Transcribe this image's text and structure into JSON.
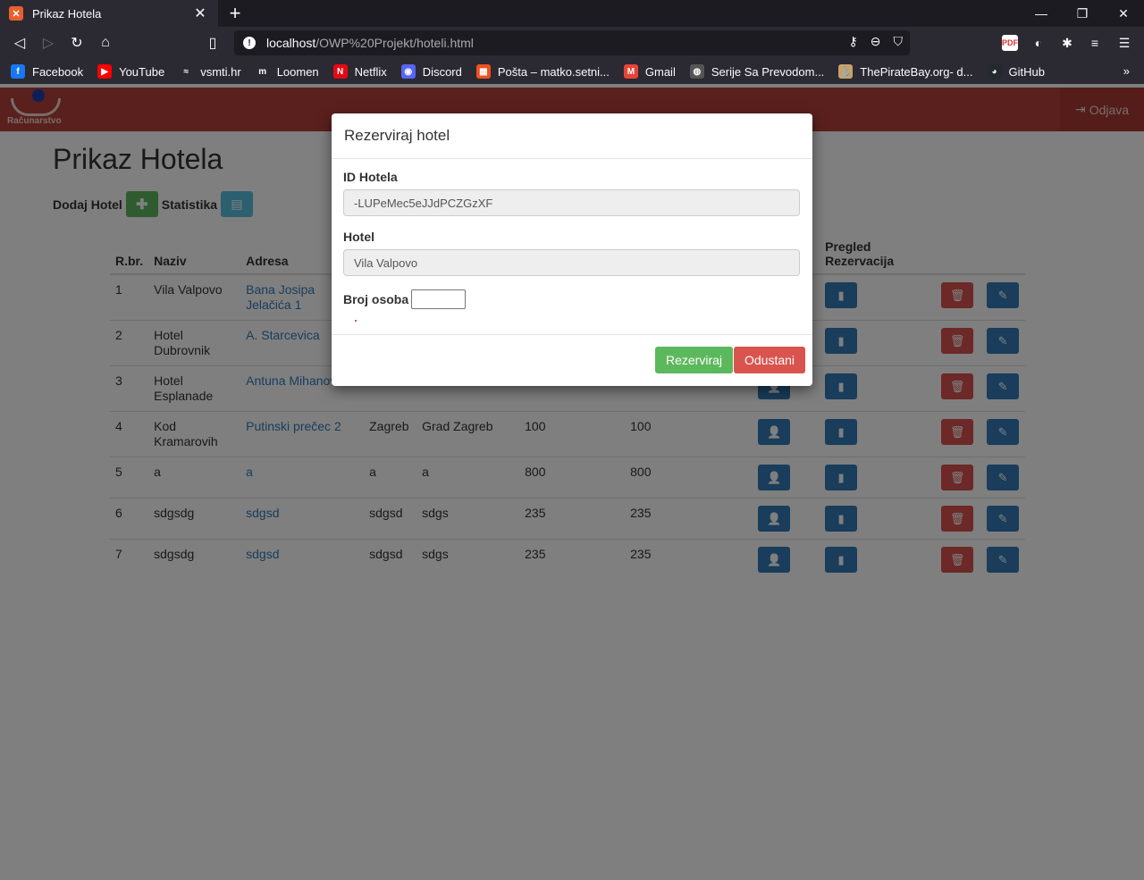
{
  "browser": {
    "tab_title": "Prikaz Hotela",
    "url_host": "localhost",
    "url_path": "/OWP%20Projekt/hoteli.html",
    "bookmarks": [
      {
        "label": "Facebook",
        "icon": "facebook-icon",
        "color": "#1877f2",
        "glyph": "f"
      },
      {
        "label": "YouTube",
        "icon": "youtube-icon",
        "color": "#ff0000",
        "glyph": "▶"
      },
      {
        "label": "vsmti.hr",
        "icon": "vsmti-icon",
        "color": "#2b2a33",
        "glyph": "≈"
      },
      {
        "label": "Loomen",
        "icon": "loomen-icon",
        "color": "#2b2a33",
        "glyph": "m"
      },
      {
        "label": "Netflix",
        "icon": "netflix-icon",
        "color": "#e50914",
        "glyph": "N"
      },
      {
        "label": "Discord",
        "icon": "discord-icon",
        "color": "#5865f2",
        "glyph": "◉"
      },
      {
        "label": "Pošta – matko.setni...",
        "icon": "microsoft-icon",
        "color": "#f25022",
        "glyph": "▦"
      },
      {
        "label": "Gmail",
        "icon": "gmail-icon",
        "color": "#ea4335",
        "glyph": "M"
      },
      {
        "label": "Serije Sa Prevodom...",
        "icon": "globe-icon",
        "color": "#555555",
        "glyph": "◍"
      },
      {
        "label": "ThePirateBay.org- d...",
        "icon": "piratebay-icon",
        "color": "#c8a06a",
        "glyph": "⚓"
      },
      {
        "label": "GitHub",
        "icon": "github-icon",
        "color": "#24292e",
        "glyph": "◕"
      }
    ]
  },
  "header": {
    "logo_text": "Računarstvo",
    "logout_label": "Odjava"
  },
  "page": {
    "title": "Prikaz Hotela",
    "add_hotel_label": "Dodaj Hotel",
    "stats_label": "Statistika"
  },
  "table": {
    "headers": [
      "R.br.",
      "Naziv",
      "Adresa",
      "",
      "",
      "",
      "",
      "",
      "Pregled Rezervacija",
      "",
      ""
    ],
    "rows": [
      {
        "rbr": "1",
        "naziv": "Vila Valpovo",
        "adresa": "Bana Josipa Jelačića 1",
        "grad": "",
        "zupanija": "",
        "kap1": "",
        "kap2": ""
      },
      {
        "rbr": "2",
        "naziv": "Hotel Dubrovnik",
        "adresa": "A. Starcevica",
        "grad": "",
        "zupanija": "",
        "kap1": "",
        "kap2": ""
      },
      {
        "rbr": "3",
        "naziv": "Hotel Esplanade",
        "adresa": "Antuna Mihanovića",
        "grad": "",
        "zupanija": "",
        "kap1": "",
        "kap2": ""
      },
      {
        "rbr": "4",
        "naziv": "Kod Kramarovih",
        "adresa": "Putinski prečec 2",
        "grad": "Zagreb",
        "zupanija": "Grad Zagreb",
        "kap1": "100",
        "kap2": "100"
      },
      {
        "rbr": "5",
        "naziv": "a",
        "adresa": "a",
        "grad": "a",
        "zupanija": "a",
        "kap1": "800",
        "kap2": "800"
      },
      {
        "rbr": "6",
        "naziv": "sdgsdg",
        "adresa": "sdgsd",
        "grad": "sdgsd",
        "zupanija": "sdgs",
        "kap1": "235",
        "kap2": "235"
      },
      {
        "rbr": "7",
        "naziv": "sdgsdg",
        "adresa": "sdgsd",
        "grad": "sdgsd",
        "zupanija": "sdgs",
        "kap1": "235",
        "kap2": "235"
      }
    ]
  },
  "modal": {
    "title": "Rezerviraj hotel",
    "id_label": "ID Hotela",
    "id_value": "-LUPeMec5eJJdPCZGzXF",
    "hotel_label": "Hotel",
    "hotel_value": "Vila Valpovo",
    "persons_label": "Broj osoba",
    "persons_value": "",
    "submit_label": "Rezerviraj",
    "cancel_label": "Odustani"
  },
  "colors": {
    "header_red": "#b5413a",
    "success": "#5cb85c",
    "info": "#5bc0de",
    "primary": "#337ab7",
    "danger": "#d9534f"
  }
}
